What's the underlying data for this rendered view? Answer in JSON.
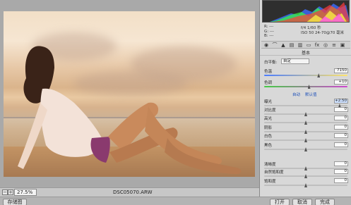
{
  "preview": {
    "filename": "DSC05070.ARW",
    "zoom": "27.5%"
  },
  "histogram": {
    "colors": [
      "#ff3b3b",
      "#3bff3b",
      "#3b6bff",
      "#ffff44",
      "#ff44ff",
      "#44ffff",
      "#ffffff"
    ]
  },
  "info": {
    "r_label": "R:",
    "g_label": "G:",
    "b_label": "B:",
    "r_value": "---",
    "g_value": "---",
    "b_value": "---",
    "aperture_shutter": "f/4  1/60 秒",
    "iso_lens": "ISO 50   24-70@70 毫米"
  },
  "panel": {
    "section_title": "基本",
    "wb_label": "白平衡:",
    "wb_value": "自定",
    "auto_link": "自动",
    "default_link": "默认值",
    "rows": [
      {
        "label": "色温",
        "value": "7150",
        "pos": 0.66
      },
      {
        "label": "色调",
        "value": "+10",
        "pos": 0.54
      },
      {
        "label": "曝光",
        "value": "+2.50",
        "pos": 0.92
      },
      {
        "label": "对比度",
        "value": "0",
        "pos": 0.5
      },
      {
        "label": "高光",
        "value": "0",
        "pos": 0.5
      },
      {
        "label": "阴影",
        "value": "0",
        "pos": 0.5
      },
      {
        "label": "白色",
        "value": "0",
        "pos": 0.5
      },
      {
        "label": "黑色",
        "value": "0",
        "pos": 0.5
      },
      {
        "label": "清晰度",
        "value": "0",
        "pos": 0.5
      },
      {
        "label": "自然饱和度",
        "value": "0",
        "pos": 0.5
      },
      {
        "label": "饱和度",
        "value": "0",
        "pos": 0.5
      }
    ]
  },
  "footer": {
    "save_label": "存储图像...",
    "open_label": "打开",
    "cancel_label": "取消",
    "done_label": "完成"
  }
}
